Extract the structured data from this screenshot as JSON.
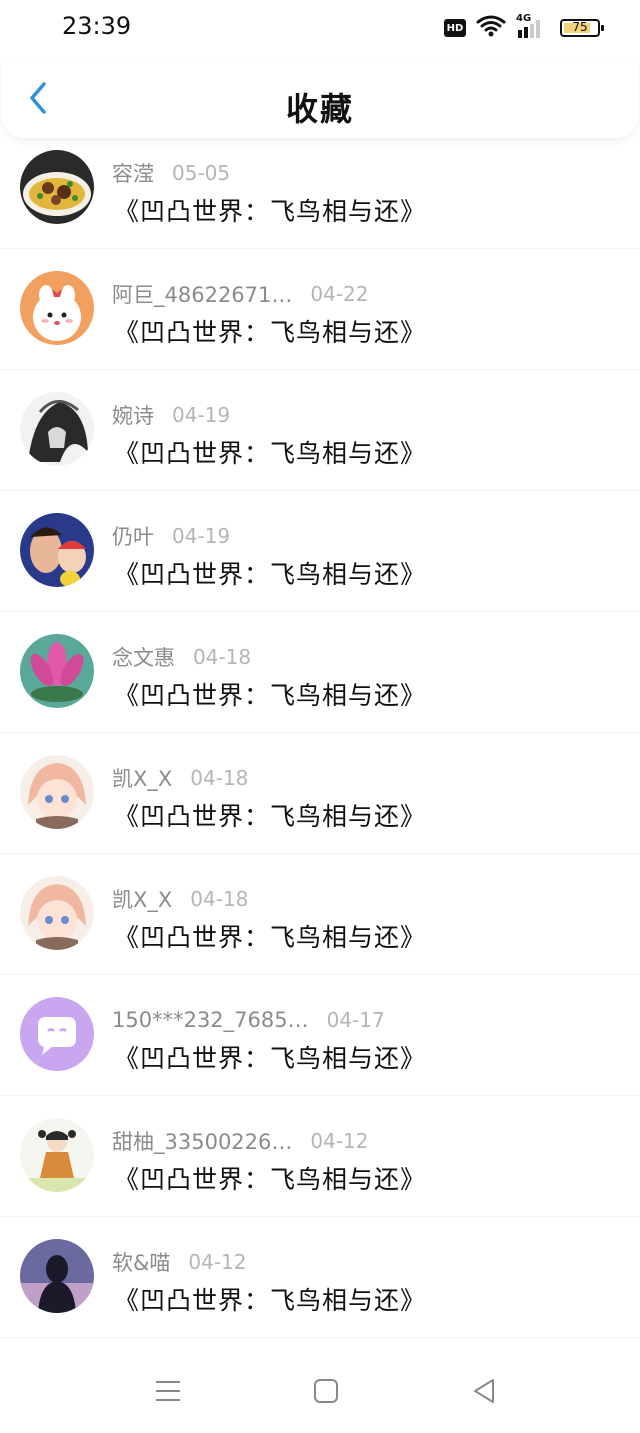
{
  "status_bar": {
    "time": "23:39",
    "hd": "HD",
    "network": "4G",
    "battery": "75"
  },
  "header": {
    "title": "收藏"
  },
  "favorites": [
    {
      "user": "容滢",
      "date": "05-05",
      "book": "《凹凸世界：飞鸟相与还》"
    },
    {
      "user": "阿巨_48622671…",
      "date": "04-22",
      "book": "《凹凸世界：飞鸟相与还》"
    },
    {
      "user": "婉诗",
      "date": "04-19",
      "book": "《凹凸世界：飞鸟相与还》"
    },
    {
      "user": "仍叶",
      "date": "04-19",
      "book": "《凹凸世界：飞鸟相与还》"
    },
    {
      "user": "念文惠",
      "date": "04-18",
      "book": "《凹凸世界：飞鸟相与还》"
    },
    {
      "user": "凯X_X",
      "date": "04-18",
      "book": "《凹凸世界：飞鸟相与还》"
    },
    {
      "user": "凯X_X",
      "date": "04-18",
      "book": "《凹凸世界：飞鸟相与还》"
    },
    {
      "user": "150***232_7685…",
      "date": "04-17",
      "book": "《凹凸世界：飞鸟相与还》"
    },
    {
      "user": "甜柚_33500226…",
      "date": "04-12",
      "book": "《凹凸世界：飞鸟相与还》"
    },
    {
      "user": "软&喵",
      "date": "04-12",
      "book": "《凹凸世界：飞鸟相与还》"
    }
  ],
  "colors": {
    "accent": "#2f8fe0",
    "username": "#8b8b8b",
    "date": "#b5b5b5",
    "title": "#111111"
  }
}
